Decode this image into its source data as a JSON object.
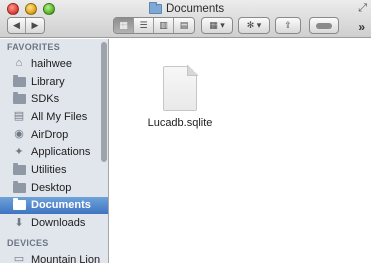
{
  "window": {
    "title": "Documents"
  },
  "toolbar": {
    "back": "◀",
    "forward": "▶",
    "view_icons": "▦",
    "view_list": "☰",
    "view_columns": "▥",
    "view_coverflow": "▤",
    "arrange": "▦ ▾",
    "action": "✻ ▾",
    "share": "⇪",
    "label": "",
    "overflow": "»"
  },
  "sidebar": {
    "favorites_header": "FAVORITES",
    "items": [
      {
        "label": "haihwee",
        "icon": "home-icon"
      },
      {
        "label": "Library",
        "icon": "folder-icon"
      },
      {
        "label": "SDKs",
        "icon": "folder-icon"
      },
      {
        "label": "All My Files",
        "icon": "all-files-icon"
      },
      {
        "label": "AirDrop",
        "icon": "airdrop-icon"
      },
      {
        "label": "Applications",
        "icon": "applications-icon"
      },
      {
        "label": "Utilities",
        "icon": "folder-icon"
      },
      {
        "label": "Desktop",
        "icon": "desktop-icon"
      },
      {
        "label": "Documents",
        "icon": "documents-icon",
        "selected": true
      },
      {
        "label": "Downloads",
        "icon": "downloads-icon"
      }
    ],
    "devices_header": "DEVICES",
    "devices": [
      {
        "label": "Mountain Lion",
        "icon": "disk-icon"
      }
    ]
  },
  "content": {
    "files": [
      {
        "name": "Lucadb.sqlite",
        "icon": "document-icon"
      }
    ]
  },
  "colors": {
    "selection": "#3f74c2",
    "sidebar_bg": "#e1e6ec"
  }
}
